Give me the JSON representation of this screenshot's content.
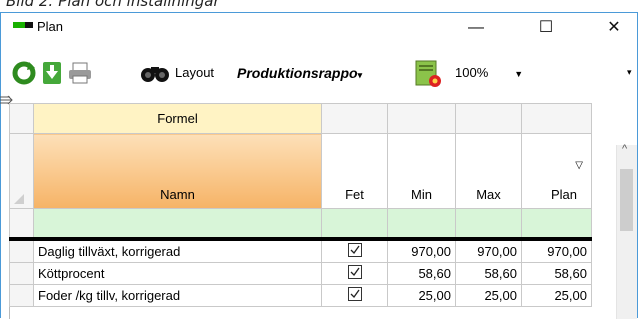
{
  "caption": "Bild 2: Plan och inställningar",
  "window": {
    "title": "Plan",
    "minimize_glyph": "—",
    "maximize_glyph": "☐",
    "close_glyph": "✕"
  },
  "toolbar": {
    "layout_label": "Layout",
    "layout_value": "Produktionsrappo",
    "zoom_value": "100%"
  },
  "grid": {
    "group_header": "Formel",
    "columns": [
      "Namn",
      "Fet",
      "Min",
      "Max",
      "Plan"
    ],
    "rows": [
      {
        "name": "Daglig tillväxt, korrigerad",
        "min": "970,00",
        "max": "970,00",
        "plan": "970,00"
      },
      {
        "name": "Köttprocent",
        "min": "58,60",
        "max": "58,60",
        "plan": "58,60"
      },
      {
        "name": "Foder /kg tillv, korrigerad",
        "min": "25,00",
        "max": "25,00",
        "plan": "25,00"
      }
    ]
  },
  "colors": {
    "window_border": "#4b9ad8",
    "header_orange": "#f6b366",
    "filter_row": "#d8f5d8",
    "group_header_bg": "#fff3c4"
  }
}
